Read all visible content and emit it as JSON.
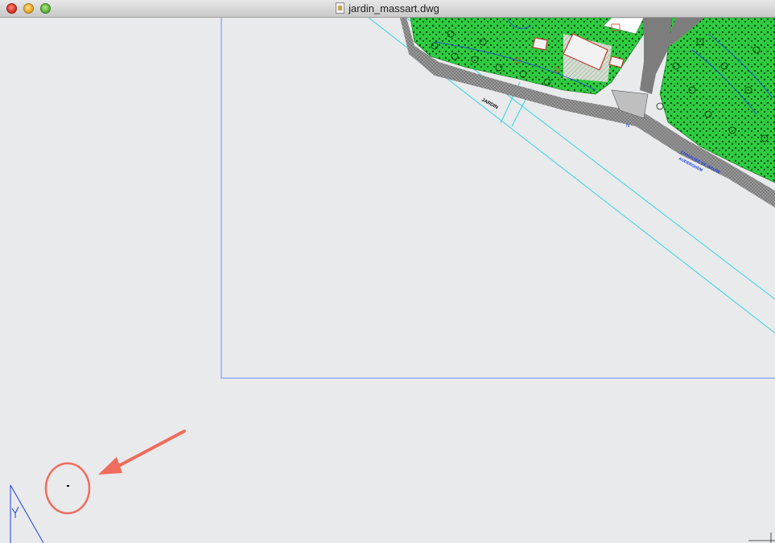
{
  "window": {
    "title": "jardin_massart.dwg"
  },
  "drawing": {
    "annotation_1": "JARDIN",
    "annotation_2": "CHAUSSEE DE WAVRE",
    "annotation_3": "AUDERGHEM",
    "annotation_4": "N"
  },
  "colors": {
    "background": "#e9eaec",
    "frame_line": "#6a8cff",
    "cyan_line": "#2fd6e0",
    "vegetation": "#2ecc40",
    "road": "#7d7d7d",
    "callout": "#f06c5c"
  },
  "icons": {
    "window_close": "close-icon",
    "window_minimize": "minimize-icon",
    "window_zoom": "zoom-icon",
    "document": "dwg-file-icon",
    "annotation_arrow": "arrow-icon",
    "annotation_circle": "circle-highlight-icon"
  }
}
